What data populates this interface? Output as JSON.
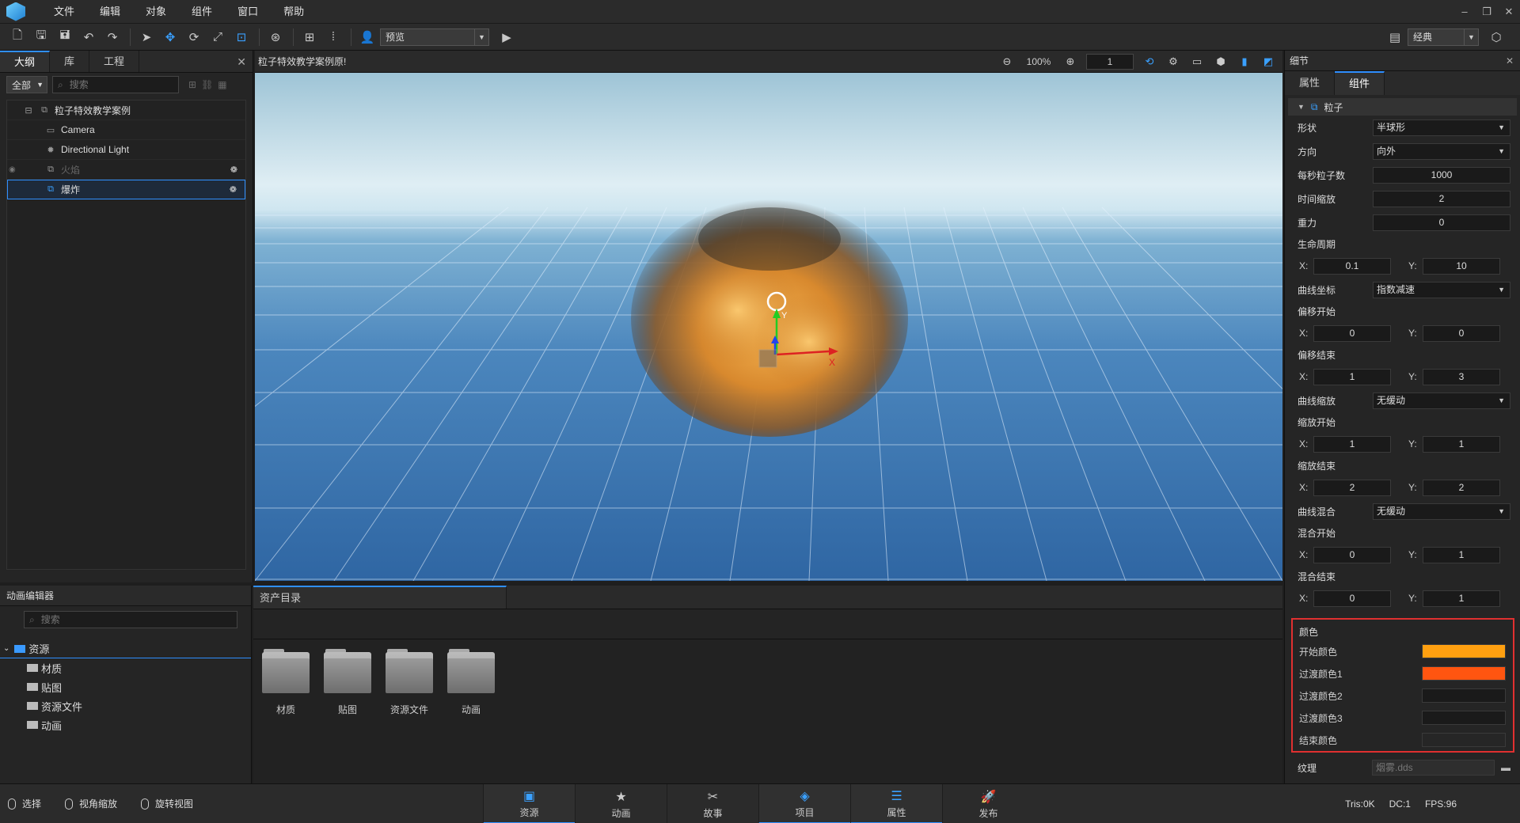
{
  "menu": {
    "items": [
      "文件",
      "编辑",
      "对象",
      "组件",
      "窗口",
      "帮助"
    ],
    "win_min": "–",
    "win_restore": "❐",
    "win_close": "✕"
  },
  "toolbar": {
    "preview_label": "预览",
    "layout_label": "经典"
  },
  "outline": {
    "tabs": [
      "大纲",
      "库",
      "工程"
    ],
    "filter": "全部",
    "search_placeholder": "搜索",
    "items": [
      {
        "label": "粒子特效教学案例",
        "icon": "scene-icon"
      },
      {
        "label": "Camera",
        "icon": "camera-icon"
      },
      {
        "label": "Directional Light",
        "icon": "light-icon"
      },
      {
        "label": "火焰",
        "icon": "particle-icon"
      },
      {
        "label": "爆炸",
        "icon": "particle-icon"
      }
    ]
  },
  "viewport": {
    "title": "粒子特效教学案例原!",
    "zoom": "100%",
    "frame": "1"
  },
  "details": {
    "header": "细节",
    "tabs": [
      "属性",
      "组件"
    ],
    "section": "粒子",
    "shape_label": "形状",
    "shape_value": "半球形",
    "direction_label": "方向",
    "direction_value": "向外",
    "rate_label": "每秒粒子数",
    "rate_value": "1000",
    "timescale_label": "时间缩放",
    "timescale_value": "2",
    "gravity_label": "重力",
    "gravity_value": "0",
    "life_label": "生命周期",
    "life_x": "0.1",
    "life_y": "10",
    "curve_coord_label": "曲线坐标",
    "curve_coord_value": "指数减速",
    "offset_start_label": "偏移开始",
    "offset_start_x": "0",
    "offset_start_y": "0",
    "offset_end_label": "偏移结束",
    "offset_end_x": "1",
    "offset_end_y": "3",
    "curve_scale_label": "曲线缩放",
    "curve_scale_value": "无缓动",
    "scale_start_label": "缩放开始",
    "scale_start_x": "1",
    "scale_start_y": "1",
    "scale_end_label": "缩放结束",
    "scale_end_x": "2",
    "scale_end_y": "2",
    "curve_blend_label": "曲线混合",
    "curve_blend_value": "无缓动",
    "blend_start_label": "混合开始",
    "blend_start_x": "0",
    "blend_start_y": "1",
    "blend_end_label": "混合结束",
    "blend_end_x": "0",
    "blend_end_y": "1",
    "x_label": "X:",
    "y_label": "Y:",
    "color_label": "颜色",
    "start_color_label": "开始颜色",
    "start_color": "#ffa010",
    "trans1_label": "过渡颜色1",
    "trans1_color": "#ff5510",
    "trans2_label": "过渡颜色2",
    "trans2_color": "#1a1a1a",
    "trans3_label": "过渡颜色3",
    "trans3_color": "#1a1a1a",
    "end_color_label": "结束颜色",
    "end_color": "#262626",
    "texture_label": "纹理",
    "texture_value": "烟雾.dds"
  },
  "anim": {
    "title": "动画编辑器",
    "search_placeholder": "搜索",
    "root": "资源",
    "folders": [
      "材质",
      "贴图",
      "资源文件",
      "动画"
    ]
  },
  "assets": {
    "tab": "资产目录",
    "items": [
      "材质",
      "贴图",
      "资源文件",
      "动画"
    ]
  },
  "status": {
    "hints": [
      "选择",
      "视角缩放",
      "旋转视图"
    ],
    "tabs": [
      {
        "label": "资源",
        "icon": "resource-icon"
      },
      {
        "label": "动画",
        "icon": "animation-icon"
      },
      {
        "label": "故事",
        "icon": "story-icon"
      },
      {
        "label": "项目",
        "icon": "project-icon"
      },
      {
        "label": "属性",
        "icon": "properties-icon"
      },
      {
        "label": "发布",
        "icon": "publish-icon"
      }
    ],
    "tris": "Tris:0K",
    "dc": "DC:1",
    "fps": "FPS:96"
  }
}
